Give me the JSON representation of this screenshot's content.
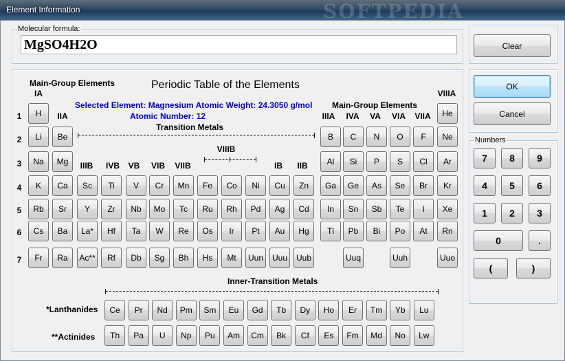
{
  "window": {
    "title": "Element Information",
    "watermark": "SOFTPEDIA"
  },
  "formula": {
    "legend": "Molecular formula:",
    "value": "MgSO4H2O"
  },
  "buttons": {
    "clear": "Clear",
    "ok": "OK",
    "cancel": "Cancel"
  },
  "numbers": {
    "legend": "Numbers",
    "keys": [
      "7",
      "8",
      "9",
      "4",
      "5",
      "6",
      "1",
      "2",
      "3",
      "0",
      ".",
      "(",
      ")"
    ]
  },
  "table": {
    "title": "Periodic Table of the Elements",
    "main_group_left": "Main-Group Elements",
    "main_group_right": "Main-Group Elements",
    "transition": "Transition Metals",
    "inner_transition": "Inner-Transition Metals",
    "lanthanides": "*Lanthanides",
    "actinides": "**Actinides",
    "selected_prefix": "Selected Element:",
    "selected_name": "Magnesium",
    "weight_prefix": "Atomic Weight:",
    "weight_value": "24.3050 g/mol",
    "number_prefix": "Atomic Number:",
    "number_value": "12",
    "selected_symbol": "Mg",
    "groups": [
      "IA",
      "IIA",
      "IIIB",
      "IVB",
      "VB",
      "VIB",
      "VIIB",
      "VIIIB",
      "IB",
      "IIB",
      "IIIA",
      "IVA",
      "VA",
      "VIA",
      "VIIA",
      "VIIIA"
    ],
    "periods": [
      "1",
      "2",
      "3",
      "4",
      "5",
      "6",
      "7"
    ],
    "rows": [
      [
        "H",
        "",
        "",
        "",
        "",
        "",
        "",
        "",
        "",
        "",
        "",
        "",
        "",
        "",
        "",
        "",
        "",
        "He"
      ],
      [
        "Li",
        "Be",
        "",
        "",
        "",
        "",
        "",
        "",
        "",
        "",
        "",
        "",
        "B",
        "C",
        "N",
        "O",
        "F",
        "Ne"
      ],
      [
        "Na",
        "Mg",
        "",
        "",
        "",
        "",
        "",
        "",
        "",
        "",
        "",
        "",
        "Al",
        "Si",
        "P",
        "S",
        "Cl",
        "Ar"
      ],
      [
        "K",
        "Ca",
        "Sc",
        "Ti",
        "V",
        "Cr",
        "Mn",
        "Fe",
        "Co",
        "Ni",
        "Cu",
        "Zn",
        "Ga",
        "Ge",
        "As",
        "Se",
        "Br",
        "Kr"
      ],
      [
        "Rb",
        "Sr",
        "Y",
        "Zr",
        "Nb",
        "Mo",
        "Tc",
        "Ru",
        "Rh",
        "Pd",
        "Ag",
        "Cd",
        "In",
        "Sn",
        "Sb",
        "Te",
        "I",
        "Xe"
      ],
      [
        "Cs",
        "Ba",
        "La*",
        "Hf",
        "Ta",
        "W",
        "Re",
        "Os",
        "Ir",
        "Pt",
        "Au",
        "Hg",
        "Tl",
        "Pb",
        "Bi",
        "Po",
        "At",
        "Rn"
      ],
      [
        "Fr",
        "Ra",
        "Ac**",
        "Rf",
        "Db",
        "Sg",
        "Bh",
        "Hs",
        "Mt",
        "Uun",
        "Uuu",
        "Uub",
        "",
        "Uuq",
        "",
        "Uuh",
        "",
        "Uuo"
      ]
    ],
    "lanthanide_row": [
      "Ce",
      "Pr",
      "Nd",
      "Pm",
      "Sm",
      "Eu",
      "Gd",
      "Tb",
      "Dy",
      "Ho",
      "Er",
      "Tm",
      "Yb",
      "Lu"
    ],
    "actinide_row": [
      "Th",
      "Pa",
      "U",
      "Np",
      "Pu",
      "Am",
      "Cm",
      "Bk",
      "Cf",
      "Es",
      "Fm",
      "Md",
      "No",
      "Lw"
    ]
  }
}
